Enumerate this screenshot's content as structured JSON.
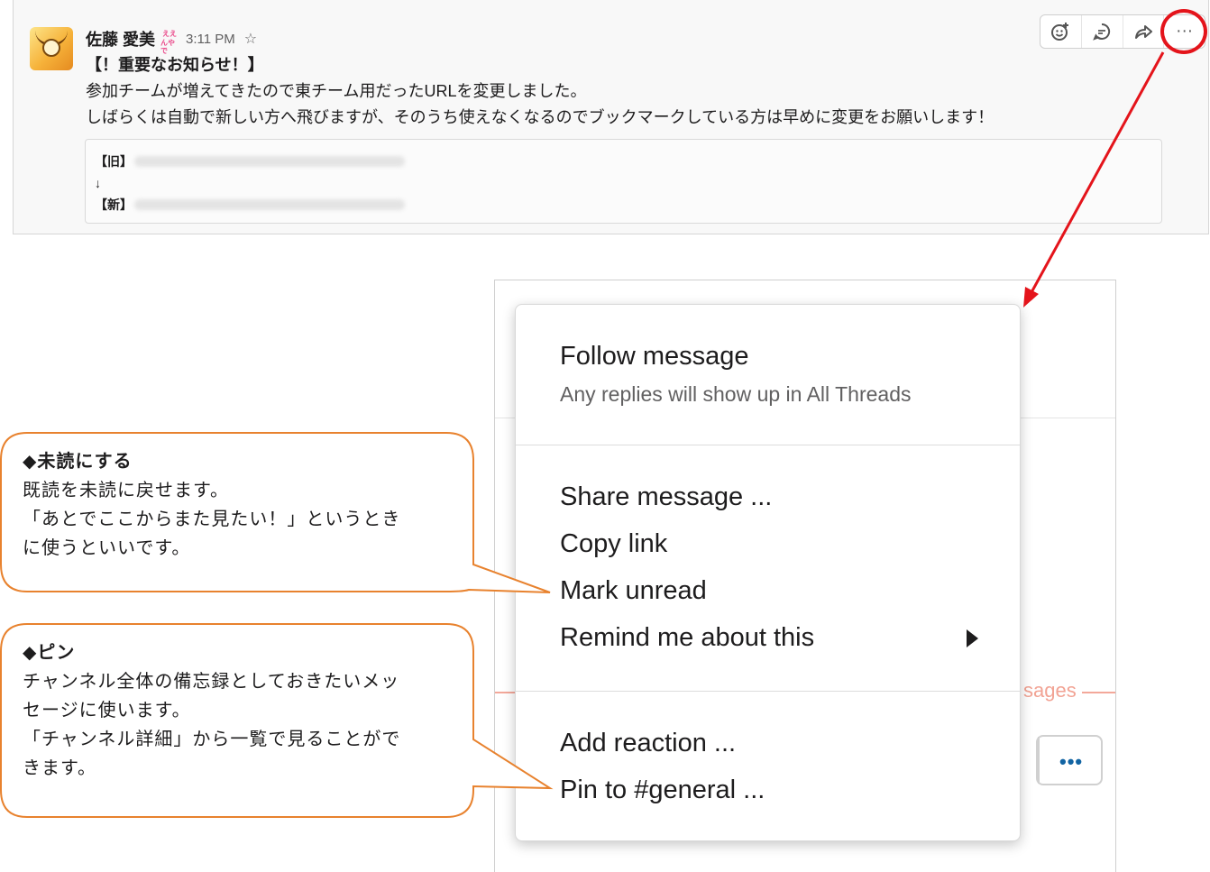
{
  "message": {
    "author": "佐藤 愛美",
    "status_emoji_text": [
      "ええ",
      "んやで"
    ],
    "time": "3:11 PM",
    "lines": [
      "【！重要なお知らせ！】",
      "参加チームが増えてきたので東チーム用だったURLを変更しました。",
      "しばらくは自動で新しい方へ飛びますが、そのうち使えなくなるのでブックマークしている方は早めに変更をお願いします！"
    ],
    "attachment": {
      "old_label": "【旧】",
      "arrow": "↓",
      "new_label": "【新】"
    }
  },
  "toolbar": {
    "icons": [
      "add-reaction-icon",
      "reply-thread-icon",
      "share-icon",
      "more-actions-icon"
    ],
    "more_label": "···"
  },
  "background": {
    "new_messages_fragment": "sages",
    "more_button_label": "•••"
  },
  "menu": {
    "follow": "Follow message",
    "follow_sub": "Any replies will show up in All Threads",
    "share": "Share message ...",
    "copy": "Copy link",
    "mark_unread": "Mark unread",
    "remind": "Remind me about this",
    "add_reaction": "Add reaction ...",
    "pin": "Pin to #general ..."
  },
  "callouts": {
    "unread": {
      "title": "◆未読にする",
      "lines": [
        "既読を未読に戻せます。",
        "「あとでここからまた見たい！」というとき",
        "に使うといいです。"
      ]
    },
    "pin": {
      "title": "◆ピン",
      "lines": [
        "チャンネル全体の備忘録としておきたいメッ",
        "セージに使います。",
        "「チャンネル詳細」から一覧で見ることがで",
        "きます。"
      ]
    }
  },
  "colors": {
    "highlight_red": "#e4141b",
    "callout_border": "#e8822e",
    "new_messages_line": "#f3a89a"
  }
}
